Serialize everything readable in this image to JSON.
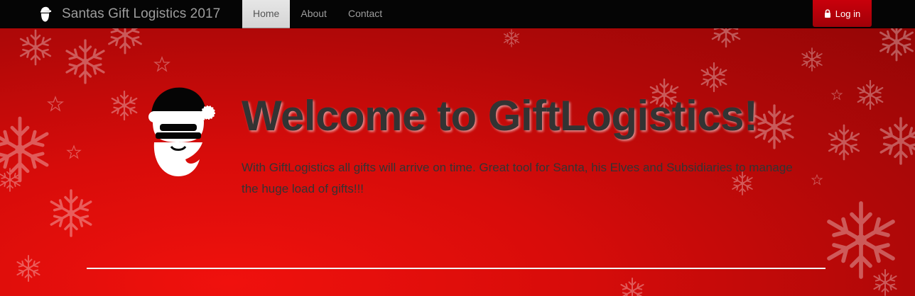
{
  "navbar": {
    "brand": "Santas Gift Logistics 2017",
    "logo_icon": "santa-icon",
    "items": [
      {
        "label": "Home",
        "active": true
      },
      {
        "label": "About",
        "active": false
      },
      {
        "label": "Contact",
        "active": false
      }
    ],
    "login_label": "Log in",
    "login_icon": "lock-icon"
  },
  "hero": {
    "logo_icon": "santa-icon",
    "title": "Welcome to GiftLogistics!",
    "text": "With GiftLogistics all gifts will arrive on time. Great tool for Santa, his Elves and Subsidiaries to manage the huge load of gifts!!!"
  },
  "colors": {
    "navbar_bg": "#050505",
    "hero_red": "#e00d0b",
    "login_bg": "#b5000a",
    "text_dark": "#333333"
  }
}
